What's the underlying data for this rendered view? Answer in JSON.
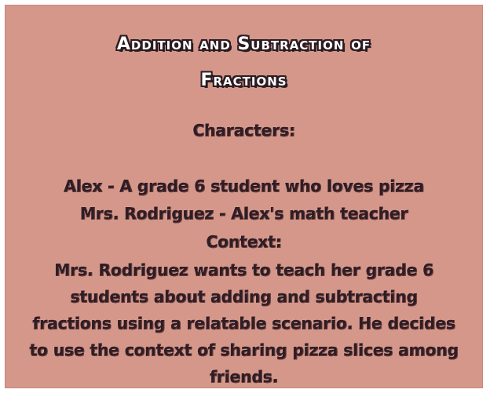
{
  "document": {
    "title_line1": "Addition and Subtraction of",
    "title_line2": "Fractions",
    "characters_heading": "Characters:",
    "character_1": "Alex - A grade 6 student who loves pizza",
    "character_2": "Mrs. Rodriguez - Alex's math teacher",
    "context_heading": "Context:",
    "context_text": "Mrs. Rodriguez wants to teach her grade 6 students about adding and subtracting fractions using a relatable scenario. He decides to use the context of sharing pizza slices among friends."
  },
  "colors": {
    "background": "#d4978a",
    "title_text": "#ffffff",
    "body_text": "#2f1d25"
  }
}
